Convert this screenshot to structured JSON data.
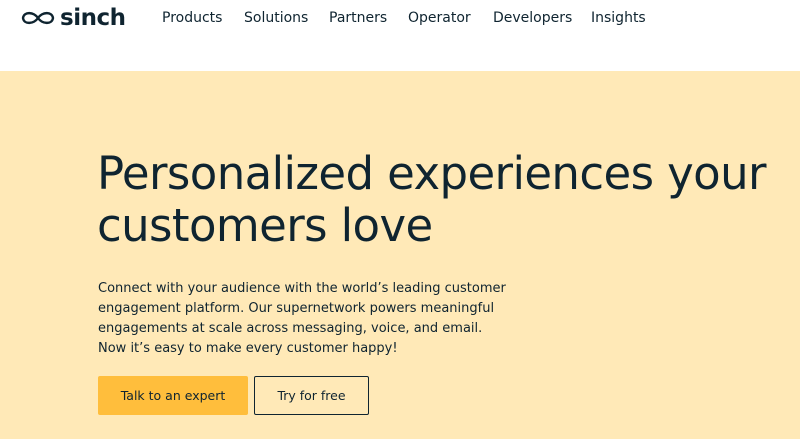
{
  "header": {
    "logo_text": "sinch",
    "nav": [
      {
        "label": "Products"
      },
      {
        "label": "Solutions"
      },
      {
        "label": "Partners"
      },
      {
        "label": "Operator"
      },
      {
        "label": "Developers"
      },
      {
        "label": "Insights"
      }
    ]
  },
  "hero": {
    "title_lines": [
      "Personalized experiences your",
      "customers love"
    ],
    "subtitle_lines": [
      "Connect with your audience with the world’s leading customer",
      "engagement platform. Our supernetwork powers meaningful",
      "engagements at scale across messaging, voice, and email.",
      "Now it’s easy to make every customer happy!"
    ],
    "primary_cta": "Talk to an expert",
    "secondary_cta": "Try for free"
  },
  "colors": {
    "hero_background": "#ffe9b7",
    "primary_button": "#ffbe3c",
    "text": "#0f2430"
  }
}
